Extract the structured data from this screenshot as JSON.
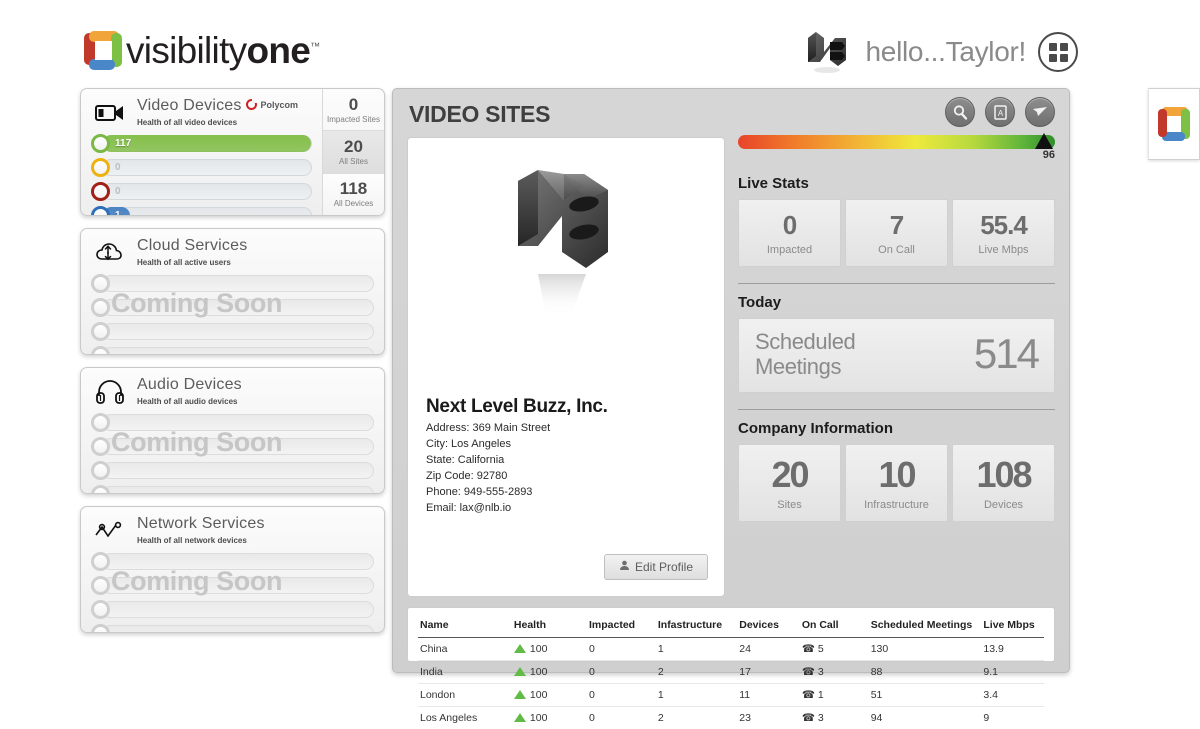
{
  "header": {
    "brand_text_light": "visibility",
    "brand_text_bold": "one",
    "brand_tm": "™",
    "greeting": "hello...Taylor!",
    "apps_icon": "grid-apps-icon",
    "user_logo_alt": "nb-3d-logo"
  },
  "sidebar": {
    "panels": [
      {
        "title": "Video Devices",
        "subtitle": "Health of all video devices",
        "icon": "video-camera-icon",
        "vendor": "Polycom",
        "coming_soon": null,
        "bars": [
          {
            "ring_color": "#7bb844",
            "fill_color": "#85bf4b",
            "value": "117",
            "percent": 100
          },
          {
            "ring_color": "#edb211",
            "fill_color": null,
            "value": "0",
            "percent": 0
          },
          {
            "ring_color": "#a01f16",
            "fill_color": null,
            "value": "0",
            "percent": 0
          },
          {
            "ring_color": "#2f6fba",
            "fill_color": "#4a83c4",
            "value": "1",
            "percent": 13
          }
        ],
        "stats": [
          {
            "num": "0",
            "label": "Impacted Sites"
          },
          {
            "num": "20",
            "label": "All Sites"
          },
          {
            "num": "118",
            "label": "All Devices"
          }
        ]
      },
      {
        "title": "Cloud Services",
        "subtitle": "Health of all active users",
        "icon": "cloud-sync-icon",
        "vendor": null,
        "coming_soon": "Coming Soon",
        "bars": [
          {
            "ring_color": "#cfcfcf",
            "fill_color": null,
            "value": "",
            "percent": 0
          },
          {
            "ring_color": "#cfcfcf",
            "fill_color": null,
            "value": "",
            "percent": 0
          },
          {
            "ring_color": "#cfcfcf",
            "fill_color": null,
            "value": "",
            "percent": 0
          },
          {
            "ring_color": "#cfcfcf",
            "fill_color": null,
            "value": "",
            "percent": 0
          }
        ],
        "stats": []
      },
      {
        "title": "Audio Devices",
        "subtitle": "Health of all audio devices",
        "icon": "headphones-icon",
        "vendor": null,
        "coming_soon": "Coming Soon",
        "bars": [
          {
            "ring_color": "#cfcfcf",
            "fill_color": null,
            "value": "",
            "percent": 0
          },
          {
            "ring_color": "#cfcfcf",
            "fill_color": null,
            "value": "",
            "percent": 0
          },
          {
            "ring_color": "#cfcfcf",
            "fill_color": null,
            "value": "",
            "percent": 0
          },
          {
            "ring_color": "#cfcfcf",
            "fill_color": null,
            "value": "",
            "percent": 0
          }
        ],
        "stats": []
      },
      {
        "title": "Network Services",
        "subtitle": "Health of all network devices",
        "icon": "network-graph-icon",
        "vendor": null,
        "coming_soon": "Coming Soon",
        "bars": [
          {
            "ring_color": "#cfcfcf",
            "fill_color": null,
            "value": "",
            "percent": 0
          },
          {
            "ring_color": "#cfcfcf",
            "fill_color": null,
            "value": "",
            "percent": 0
          },
          {
            "ring_color": "#cfcfcf",
            "fill_color": null,
            "value": "",
            "percent": 0
          },
          {
            "ring_color": "#cfcfcf",
            "fill_color": null,
            "value": "",
            "percent": 0
          }
        ],
        "stats": []
      }
    ]
  },
  "main": {
    "title": "VIDEO SITES",
    "toolbar": [
      {
        "icon": "search-icon",
        "name": "search-button"
      },
      {
        "icon": "pdf-export-icon",
        "name": "pdf-export-button"
      },
      {
        "icon": "send-paper-plane-icon",
        "name": "send-button"
      }
    ],
    "gauge": {
      "value": "96",
      "min": 0,
      "max": 100
    },
    "profile": {
      "company_name": "Next Level Buzz, Inc.",
      "address": "Address: 369 Main Street",
      "city": "City: Los Angeles",
      "state": "State: California",
      "zip": "Zip Code: 92780",
      "phone": "Phone: 949-555-2893",
      "email": "Email: lax@nlb.io",
      "edit_button": "Edit Profile",
      "edit_icon": "user-icon"
    },
    "live_stats": {
      "title": "Live Stats",
      "cells": [
        {
          "num": "0",
          "label": "Impacted"
        },
        {
          "num": "7",
          "label": "On Call"
        },
        {
          "num": "55.4",
          "label": "Live Mbps"
        }
      ]
    },
    "today": {
      "title": "Today",
      "label_line1": "Scheduled",
      "label_line2": "Meetings",
      "value": "514"
    },
    "company_information": {
      "title": "Company Information",
      "cells": [
        {
          "num": "20",
          "label": "Sites"
        },
        {
          "num": "10",
          "label": "Infrastructure"
        },
        {
          "num": "108",
          "label": "Devices"
        }
      ]
    },
    "table": {
      "columns": [
        "Name",
        "Health",
        "Impacted",
        "Infastructure",
        "Devices",
        "On Call",
        "Scheduled Meetings",
        "Live Mbps"
      ],
      "rows": [
        {
          "name": "China",
          "health": "100",
          "impacted": "0",
          "infrastructure": "1",
          "devices": "24",
          "on_call": "5",
          "scheduled_meetings": "130",
          "live_mbps": "13.9"
        },
        {
          "name": "India",
          "health": "100",
          "impacted": "0",
          "infrastructure": "2",
          "devices": "17",
          "on_call": "3",
          "scheduled_meetings": "88",
          "live_mbps": "9.1"
        },
        {
          "name": "London",
          "health": "100",
          "impacted": "0",
          "infrastructure": "1",
          "devices": "11",
          "on_call": "1",
          "scheduled_meetings": "51",
          "live_mbps": "3.4"
        },
        {
          "name": "Los Angeles",
          "health": "100",
          "impacted": "0",
          "infrastructure": "2",
          "devices": "23",
          "on_call": "3",
          "scheduled_meetings": "94",
          "live_mbps": "9"
        }
      ]
    }
  },
  "edge_tab": {
    "icon": "visibilityone-square-logo"
  },
  "colors": {
    "green": "#7bb844",
    "yellow": "#edb211",
    "red": "#a01f16",
    "blue": "#2f6fba",
    "gauge_green": "#2f8f2a",
    "gauge_red": "#e8442a"
  }
}
